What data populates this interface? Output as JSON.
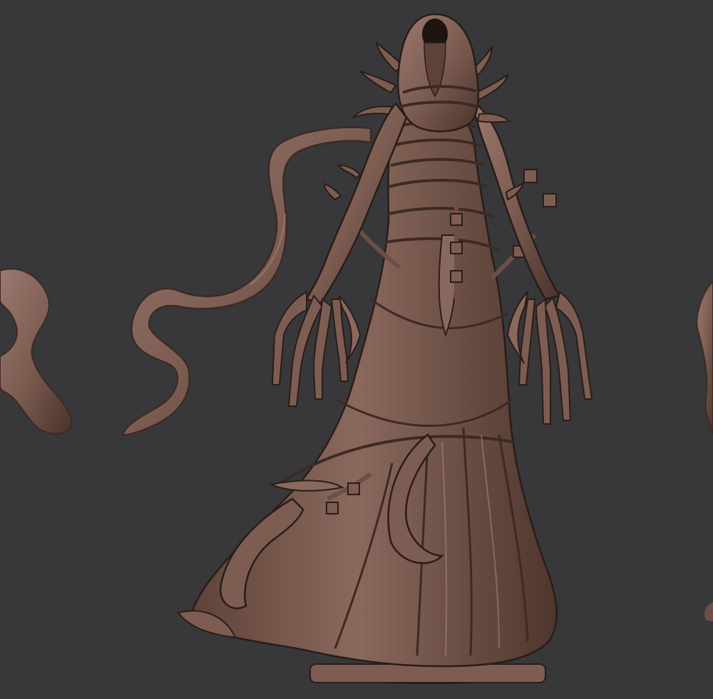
{
  "scene": {
    "subject": "hooded-wraith-sculpt",
    "background_color": "#38383a",
    "clay_base_color": "#7d5d52",
    "clay_shadow_color": "#3c2a24",
    "clay_highlight_color": "#b08d80"
  },
  "icons": {
    "figure": "hooded-wraith-figure",
    "cloth_left": "floating-cloth-ribbon",
    "base": "round-display-base"
  }
}
